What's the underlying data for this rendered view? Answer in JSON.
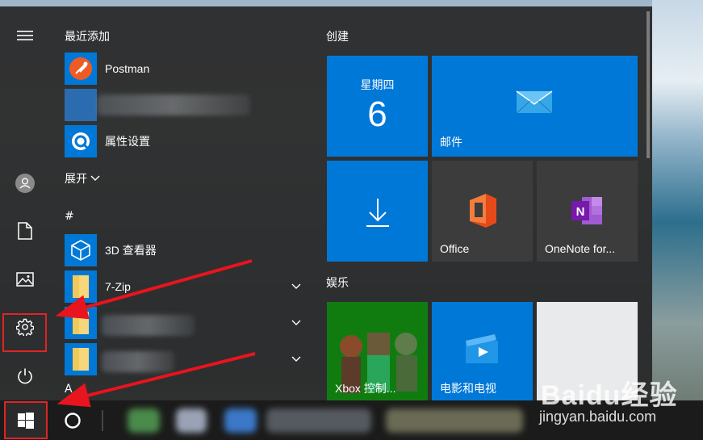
{
  "start_menu": {
    "recent_header": "最近添加",
    "recent_apps": [
      {
        "label": "Postman",
        "icon": "postman-icon"
      },
      {
        "label": "",
        "icon": "blurred-app-icon"
      },
      {
        "label": "属性设置",
        "icon": "property-settings-icon"
      }
    ],
    "expand_label": "展开",
    "hash_header": "#",
    "apps": [
      {
        "label": "3D 查看器",
        "icon": "3d-viewer-icon"
      },
      {
        "label": "7-Zip",
        "icon": "folder-icon"
      },
      {
        "label": "",
        "icon": "folder-icon"
      },
      {
        "label": "",
        "icon": "folder-icon"
      }
    ],
    "next_letter": "A"
  },
  "tiles": {
    "create_header": "创建",
    "calendar": {
      "weekday": "星期四",
      "day": "6"
    },
    "mail_label": "邮件",
    "office_label": "Office",
    "onenote_label": "OneNote for...",
    "entertainment_header": "娱乐",
    "xbox_label": "Xbox 控制...",
    "movies_label": "电影和电视"
  },
  "watermark": {
    "logo": "Baidu经验",
    "url": "jingyan.baidu.com"
  },
  "colors": {
    "accent": "#0078d7",
    "highlight_box": "#e02424",
    "arrow": "#e8141e"
  }
}
